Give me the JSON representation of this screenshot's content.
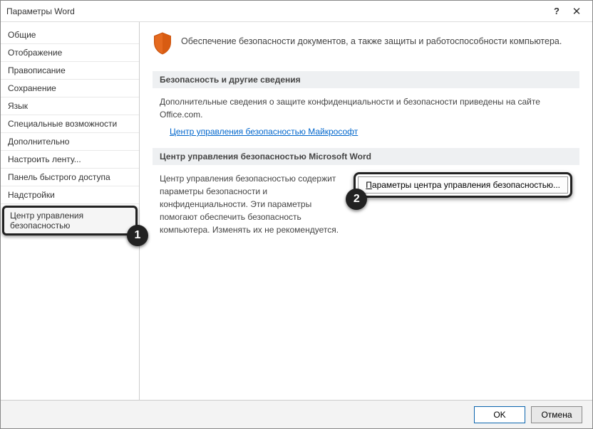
{
  "window": {
    "title": "Параметры Word",
    "help_label": "?",
    "close_label": "✕"
  },
  "sidebar": {
    "items": [
      {
        "label": "Общие"
      },
      {
        "label": "Отображение"
      },
      {
        "label": "Правописание"
      },
      {
        "label": "Сохранение"
      },
      {
        "label": "Язык"
      },
      {
        "label": "Специальные возможности"
      },
      {
        "label": "Дополнительно"
      },
      {
        "label": "Настроить ленту..."
      },
      {
        "label": "Панель быстрого доступа"
      },
      {
        "label": "Надстройки"
      },
      {
        "label": "Центр управления безопасностью"
      }
    ]
  },
  "content": {
    "header_text": "Обеспечение безопасности документов, а также защиты и работоспособности компьютера.",
    "section1_heading": "Безопасность и другие сведения",
    "section1_body": "Дополнительные сведения о защите конфиденциальности и безопасности приведены на сайте Office.com.",
    "section1_link": "Центр управления безопасностью Майкрософт",
    "section2_heading": "Центр управления безопасностью Microsoft Word",
    "section2_body": "Центр управления безопасностью содержит параметры безопасности и конфиденциальности. Эти параметры помогают обеспечить безопасность компьютера. Изменять их не рекомендуется.",
    "trust_button": "Параметры центра управления безопасностью..."
  },
  "steps": {
    "one": "1",
    "two": "2"
  },
  "footer": {
    "ok": "OK",
    "cancel": "Отмена"
  }
}
